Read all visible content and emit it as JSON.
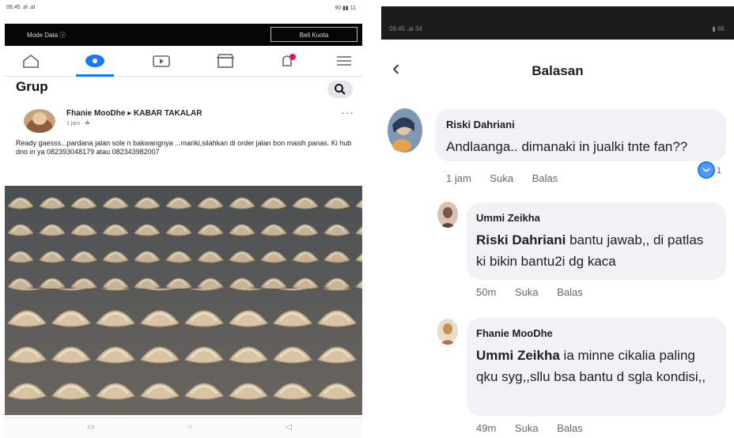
{
  "left": {
    "status_left": "09.45 .al .al",
    "status_right": "90 ▮▮ 11",
    "mode_text": "Mode Data ⓘ",
    "buy_button": "Beli Kuota",
    "nav_icons": [
      "home-icon",
      "groups-icon",
      "watch-icon",
      "marketplace-icon",
      "notifications-icon",
      "menu-icon"
    ],
    "header_title": "Grup",
    "post": {
      "author": "Fhanie MooDhe ▸ KABAR TAKALAR",
      "meta": "1 jam · ☘",
      "more": "···",
      "text": "Ready gaesss...pardana jalan sole n bakwangnya ...mariki,silahkan di order jalan bon masih panas. Ki hub dno in ya 082393048179 atau 082343982007"
    },
    "accent": "#1877f2"
  },
  "right": {
    "status_left": "09.45 .al 34",
    "status_right": "▮ 86",
    "header_title": "Balasan",
    "comments": [
      {
        "name": "Riski Dahriani",
        "mention": "",
        "text": "Andlaanga.. dimanaki in jualki tnte fan??",
        "time": "1 jam",
        "like": "Suka",
        "reply": "Balas",
        "reaction_count": "1"
      },
      {
        "name": "Ummi Zeikha",
        "mention": "Riski Dahriani",
        "text": " bantu jawab,, di patlas ki bikin bantu2i dg kaca",
        "time": "50m",
        "like": "Suka",
        "reply": "Balas"
      },
      {
        "name": "Fhanie MooDhe",
        "mention": "Ummi Zeikha",
        "text": " ia minne cikalia paling qku syg,,sllu bsa bantu d sgla kondisi,,",
        "time": "49m",
        "like": "Suka",
        "reply": "Balas"
      }
    ]
  }
}
